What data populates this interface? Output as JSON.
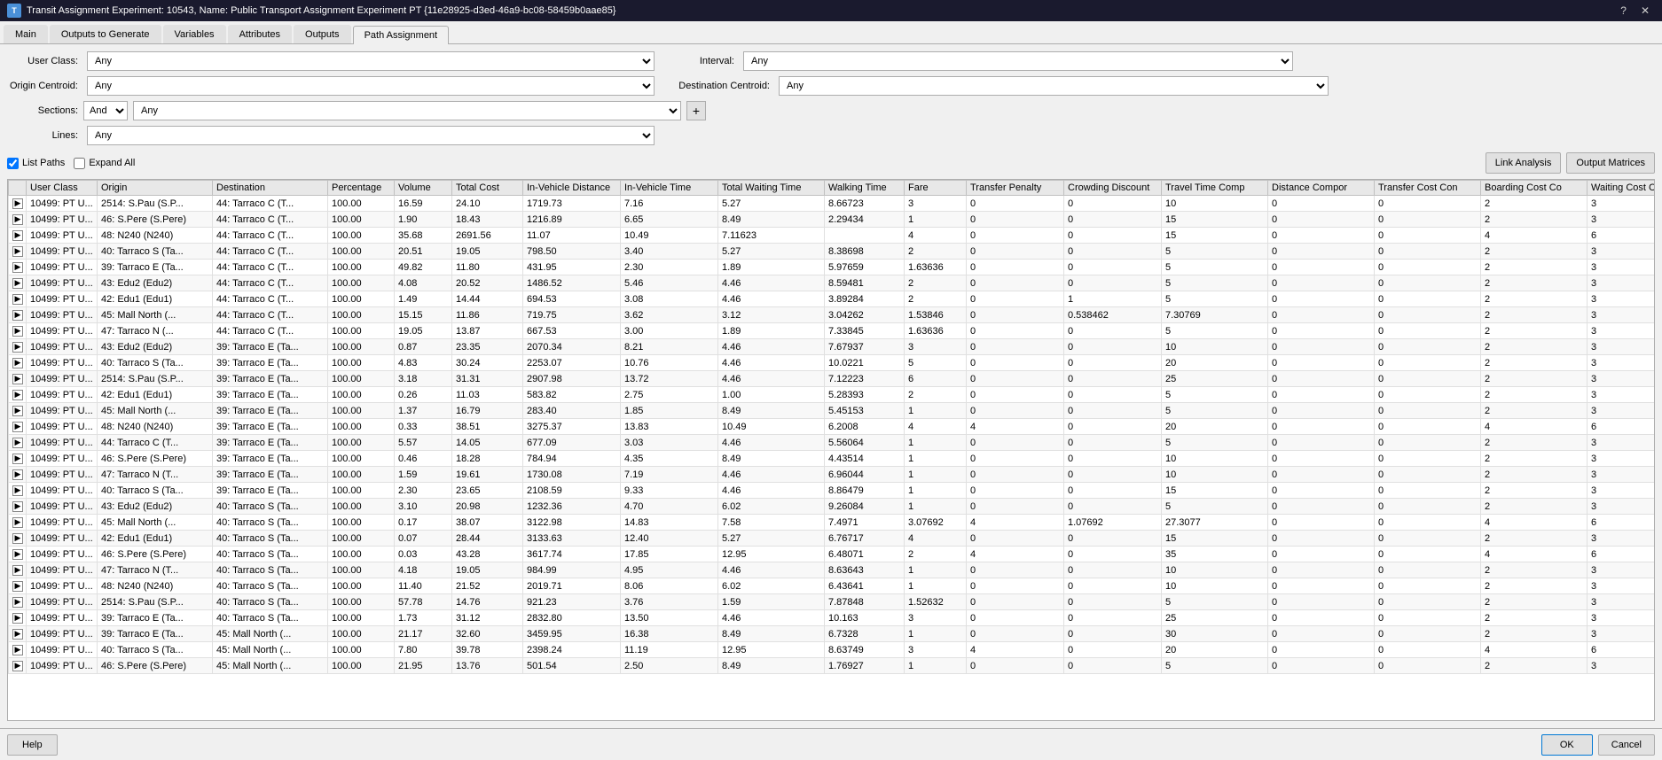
{
  "titleBar": {
    "title": "Transit Assignment Experiment: 10543, Name: Public Transport Assignment Experiment PT {11e28925-d3ed-46a9-bc08-58459b0aae85}",
    "helpBtn": "?",
    "closeBtn": "✕"
  },
  "tabs": [
    {
      "label": "Main",
      "active": false
    },
    {
      "label": "Outputs to Generate",
      "active": false
    },
    {
      "label": "Variables",
      "active": false
    },
    {
      "label": "Attributes",
      "active": false
    },
    {
      "label": "Outputs",
      "active": false
    },
    {
      "label": "Path Assignment",
      "active": true
    }
  ],
  "filters": {
    "userClassLabel": "User Class:",
    "userClassValue": "Any",
    "intervalLabel": "Interval:",
    "intervalValue": "Any",
    "originCentroidLabel": "Origin Centroid:",
    "originCentroidValue": "Any",
    "destCentroidLabel": "Destination Centroid:",
    "destCentroidValue": "Any",
    "sectionsLabel": "Sections:",
    "andValue": "And",
    "sectionsValue": "Any",
    "addBtn": "+",
    "linesLabel": "Lines:",
    "linesValue": "Any"
  },
  "toolbar": {
    "listPathsLabel": "List Paths",
    "expandAllLabel": "Expand All",
    "linkAnalysisBtn": "Link Analysis",
    "outputMatricesBtn": "Output Matrices"
  },
  "tableColumns": [
    {
      "id": "expand",
      "label": ""
    },
    {
      "id": "userClass",
      "label": "User Class"
    },
    {
      "id": "origin",
      "label": "Origin"
    },
    {
      "id": "destination",
      "label": "Destination"
    },
    {
      "id": "percentage",
      "label": "Percentage"
    },
    {
      "id": "volume",
      "label": "Volume"
    },
    {
      "id": "totalCost",
      "label": "Total Cost"
    },
    {
      "id": "inVehicleDistance",
      "label": "In-Vehicle Distance"
    },
    {
      "id": "inVehicleTime",
      "label": "In-Vehicle Time"
    },
    {
      "id": "totalWaitingTime",
      "label": "Total Waiting Time"
    },
    {
      "id": "walkingTime",
      "label": "Walking Time"
    },
    {
      "id": "fare",
      "label": "Fare"
    },
    {
      "id": "transferPenalty",
      "label": "Transfer Penalty"
    },
    {
      "id": "crowdingDiscount",
      "label": "Crowding Discount"
    },
    {
      "id": "travelTimeComp",
      "label": "Travel Time Comp"
    },
    {
      "id": "distanceComp",
      "label": "Distance Compor"
    },
    {
      "id": "transferCostCon",
      "label": "Transfer Cost Con"
    },
    {
      "id": "boardingCostCo",
      "label": "Boarding Cost Co"
    },
    {
      "id": "waitingCostCon",
      "label": "Waiting Cost Con"
    }
  ],
  "tableRows": [
    {
      "expand": true,
      "userClass": "10499: PT U...",
      "origin": "2514: S.Pau (S.P...",
      "dest": "44: Tarraco C (T...",
      "pct": "100.00",
      "vol": "16.59",
      "cost": "24.10",
      "invDist": "1719.73",
      "invTime": "7.16",
      "wait": "5.27",
      "walk": "8.66723",
      "fare": "3",
      "transfer": "0",
      "crowd": "0",
      "travelComp": "10",
      "distComp": "0",
      "transferCost": "0",
      "boarding": "2",
      "waitCost": "3"
    },
    {
      "expand": true,
      "userClass": "10499: PT U...",
      "origin": "46: S.Pere (S.Pere)",
      "dest": "44: Tarraco C (T...",
      "pct": "100.00",
      "vol": "1.90",
      "cost": "18.43",
      "invDist": "1216.89",
      "invTime": "6.65",
      "wait": "8.49",
      "walk": "2.29434",
      "fare": "1",
      "transfer": "0",
      "crowd": "0",
      "travelComp": "15",
      "distComp": "0",
      "transferCost": "0",
      "boarding": "2",
      "waitCost": "3"
    },
    {
      "expand": true,
      "userClass": "10499: PT U...",
      "origin": "48: N240 (N240)",
      "dest": "44: Tarraco C (T...",
      "pct": "100.00",
      "vol": "35.68",
      "cost": "2691.56",
      "invDist": "11.07",
      "invTime": "10.49",
      "wait": "7.11623",
      "fare": "4",
      "transfer": "0",
      "crowd": "0",
      "travelComp": "15",
      "distComp": "0",
      "transferCost": "0",
      "boarding": "4",
      "waitCost": "6"
    },
    {
      "expand": true,
      "userClass": "10499: PT U...",
      "origin": "40: Tarraco S (Ta...",
      "dest": "44: Tarraco C (T...",
      "pct": "100.00",
      "vol": "20.51",
      "cost": "19.05",
      "invDist": "798.50",
      "invTime": "3.40",
      "wait": "5.27",
      "walk": "8.38698",
      "fare": "2",
      "transfer": "0",
      "crowd": "0",
      "travelComp": "5",
      "distComp": "0",
      "transferCost": "0",
      "boarding": "2",
      "waitCost": "3"
    },
    {
      "expand": true,
      "userClass": "10499: PT U...",
      "origin": "39: Tarraco E (Ta...",
      "dest": "44: Tarraco C (T...",
      "pct": "100.00",
      "vol": "49.82",
      "cost": "11.80",
      "invDist": "431.95",
      "invTime": "2.30",
      "wait": "1.89",
      "walk": "5.97659",
      "fare": "1.63636",
      "transfer": "0",
      "crowd": "0",
      "travelComp": "5",
      "distComp": "0",
      "transferCost": "0",
      "boarding": "2",
      "waitCost": "3"
    },
    {
      "expand": true,
      "userClass": "10499: PT U...",
      "origin": "43: Edu2 (Edu2)",
      "dest": "44: Tarraco C (T...",
      "pct": "100.00",
      "vol": "4.08",
      "cost": "20.52",
      "invDist": "1486.52",
      "invTime": "5.46",
      "wait": "4.46",
      "walk": "8.59481",
      "fare": "2",
      "transfer": "0",
      "crowd": "0",
      "travelComp": "5",
      "distComp": "0",
      "transferCost": "0",
      "boarding": "2",
      "waitCost": "3"
    },
    {
      "expand": true,
      "userClass": "10499: PT U...",
      "origin": "42: Edu1 (Edu1)",
      "dest": "44: Tarraco C (T...",
      "pct": "100.00",
      "vol": "1.49",
      "cost": "14.44",
      "invDist": "694.53",
      "invTime": "3.08",
      "wait": "4.46",
      "walk": "3.89284",
      "fare": "2",
      "transfer": "0",
      "crowd": "1",
      "travelComp": "5",
      "distComp": "0",
      "transferCost": "0",
      "boarding": "2",
      "waitCost": "3"
    },
    {
      "expand": true,
      "userClass": "10499: PT U...",
      "origin": "45: Mall North (...",
      "dest": "44: Tarraco C (T...",
      "pct": "100.00",
      "vol": "15.15",
      "cost": "11.86",
      "invDist": "719.75",
      "invTime": "3.62",
      "wait": "3.12",
      "walk": "3.04262",
      "fare": "1.53846",
      "transfer": "0",
      "crowd": "0.538462",
      "travelComp": "7.30769",
      "distComp": "0",
      "transferCost": "0",
      "boarding": "2",
      "waitCost": "3"
    },
    {
      "expand": true,
      "userClass": "10499: PT U...",
      "origin": "47: Tarraco N (...",
      "dest": "44: Tarraco C (T...",
      "pct": "100.00",
      "vol": "19.05",
      "cost": "13.87",
      "invDist": "667.53",
      "invTime": "3.00",
      "wait": "1.89",
      "walk": "7.33845",
      "fare": "1.63636",
      "transfer": "0",
      "crowd": "0",
      "travelComp": "5",
      "distComp": "0",
      "transferCost": "0",
      "boarding": "2",
      "waitCost": "3"
    },
    {
      "expand": true,
      "userClass": "10499: PT U...",
      "origin": "43: Edu2 (Edu2)",
      "dest": "39: Tarraco E (Ta...",
      "pct": "100.00",
      "vol": "0.87",
      "cost": "23.35",
      "invDist": "2070.34",
      "invTime": "8.21",
      "wait": "4.46",
      "walk": "7.67937",
      "fare": "3",
      "transfer": "0",
      "crowd": "0",
      "travelComp": "10",
      "distComp": "0",
      "transferCost": "0",
      "boarding": "2",
      "waitCost": "3"
    },
    {
      "expand": true,
      "userClass": "10499: PT U...",
      "origin": "40: Tarraco S (Ta...",
      "dest": "39: Tarraco E (Ta...",
      "pct": "100.00",
      "vol": "4.83",
      "cost": "30.24",
      "invDist": "2253.07",
      "invTime": "10.76",
      "wait": "4.46",
      "walk": "10.0221",
      "fare": "5",
      "transfer": "0",
      "crowd": "0",
      "travelComp": "20",
      "distComp": "0",
      "transferCost": "0",
      "boarding": "2",
      "waitCost": "3"
    },
    {
      "expand": true,
      "userClass": "10499: PT U...",
      "origin": "2514: S.Pau (S.P...",
      "dest": "39: Tarraco E (Ta...",
      "pct": "100.00",
      "vol": "3.18",
      "cost": "31.31",
      "invDist": "2907.98",
      "invTime": "13.72",
      "wait": "4.46",
      "walk": "7.12223",
      "fare": "6",
      "transfer": "0",
      "crowd": "0",
      "travelComp": "25",
      "distComp": "0",
      "transferCost": "0",
      "boarding": "2",
      "waitCost": "3"
    },
    {
      "expand": true,
      "userClass": "10499: PT U...",
      "origin": "42: Edu1 (Edu1)",
      "dest": "39: Tarraco E (Ta...",
      "pct": "100.00",
      "vol": "0.26",
      "cost": "11.03",
      "invDist": "583.82",
      "invTime": "2.75",
      "wait": "1.00",
      "walk": "5.28393",
      "fare": "2",
      "transfer": "0",
      "crowd": "0",
      "travelComp": "5",
      "distComp": "0",
      "transferCost": "0",
      "boarding": "2",
      "waitCost": "3"
    },
    {
      "expand": true,
      "userClass": "10499: PT U...",
      "origin": "45: Mall North (...",
      "dest": "39: Tarraco E (Ta...",
      "pct": "100.00",
      "vol": "1.37",
      "cost": "16.79",
      "invDist": "283.40",
      "invTime": "1.85",
      "wait": "8.49",
      "walk": "5.45153",
      "fare": "1",
      "transfer": "0",
      "crowd": "0",
      "travelComp": "5",
      "distComp": "0",
      "transferCost": "0",
      "boarding": "2",
      "waitCost": "3"
    },
    {
      "expand": true,
      "userClass": "10499: PT U...",
      "origin": "48: N240 (N240)",
      "dest": "39: Tarraco E (Ta...",
      "pct": "100.00",
      "vol": "0.33",
      "cost": "38.51",
      "invDist": "3275.37",
      "invTime": "13.83",
      "wait": "10.49",
      "walk": "6.2008",
      "fare": "4",
      "transfer": "4",
      "crowd": "0",
      "travelComp": "20",
      "distComp": "0",
      "transferCost": "0",
      "boarding": "4",
      "waitCost": "6"
    },
    {
      "expand": true,
      "userClass": "10499: PT U...",
      "origin": "44: Tarraco C (T...",
      "dest": "39: Tarraco E (Ta...",
      "pct": "100.00",
      "vol": "5.57",
      "cost": "14.05",
      "invDist": "677.09",
      "invTime": "3.03",
      "wait": "4.46",
      "walk": "5.56064",
      "fare": "1",
      "transfer": "0",
      "crowd": "0",
      "travelComp": "5",
      "distComp": "0",
      "transferCost": "0",
      "boarding": "2",
      "waitCost": "3"
    },
    {
      "expand": true,
      "userClass": "10499: PT U...",
      "origin": "46: S.Pere (S.Pere)",
      "dest": "39: Tarraco E (Ta...",
      "pct": "100.00",
      "vol": "0.46",
      "cost": "18.28",
      "invDist": "784.94",
      "invTime": "4.35",
      "wait": "8.49",
      "walk": "4.43514",
      "fare": "1",
      "transfer": "0",
      "crowd": "0",
      "travelComp": "10",
      "distComp": "0",
      "transferCost": "0",
      "boarding": "2",
      "waitCost": "3"
    },
    {
      "expand": true,
      "userClass": "10499: PT U...",
      "origin": "47: Tarraco N (T...",
      "dest": "39: Tarraco E (Ta...",
      "pct": "100.00",
      "vol": "1.59",
      "cost": "19.61",
      "invDist": "1730.08",
      "invTime": "7.19",
      "wait": "4.46",
      "walk": "6.96044",
      "fare": "1",
      "transfer": "0",
      "crowd": "0",
      "travelComp": "10",
      "distComp": "0",
      "transferCost": "0",
      "boarding": "2",
      "waitCost": "3"
    },
    {
      "expand": true,
      "userClass": "10499: PT U...",
      "origin": "40: Tarraco S (Ta...",
      "dest": "39: Tarraco E (Ta...",
      "pct": "100.00",
      "vol": "2.30",
      "cost": "23.65",
      "invDist": "2108.59",
      "invTime": "9.33",
      "wait": "4.46",
      "walk": "8.86479",
      "fare": "1",
      "transfer": "0",
      "crowd": "0",
      "travelComp": "15",
      "distComp": "0",
      "transferCost": "0",
      "boarding": "2",
      "waitCost": "3"
    },
    {
      "expand": true,
      "userClass": "10499: PT U...",
      "origin": "43: Edu2 (Edu2)",
      "dest": "40: Tarraco S (Ta...",
      "pct": "100.00",
      "vol": "3.10",
      "cost": "20.98",
      "invDist": "1232.36",
      "invTime": "4.70",
      "wait": "6.02",
      "walk": "9.26084",
      "fare": "1",
      "transfer": "0",
      "crowd": "0",
      "travelComp": "5",
      "distComp": "0",
      "transferCost": "0",
      "boarding": "2",
      "waitCost": "3"
    },
    {
      "expand": true,
      "userClass": "10499: PT U...",
      "origin": "45: Mall North (...",
      "dest": "40: Tarraco S (Ta...",
      "pct": "100.00",
      "vol": "0.17",
      "cost": "38.07",
      "invDist": "3122.98",
      "invTime": "14.83",
      "wait": "7.58",
      "walk": "7.4971",
      "fare": "3.07692",
      "transfer": "4",
      "crowd": "1.07692",
      "travelComp": "27.3077",
      "distComp": "0",
      "transferCost": "0",
      "boarding": "4",
      "waitCost": "6"
    },
    {
      "expand": true,
      "userClass": "10499: PT U...",
      "origin": "42: Edu1 (Edu1)",
      "dest": "40: Tarraco S (Ta...",
      "pct": "100.00",
      "vol": "0.07",
      "cost": "28.44",
      "invDist": "3133.63",
      "invTime": "12.40",
      "wait": "5.27",
      "walk": "6.76717",
      "fare": "4",
      "transfer": "0",
      "crowd": "0",
      "travelComp": "15",
      "distComp": "0",
      "transferCost": "0",
      "boarding": "2",
      "waitCost": "3"
    },
    {
      "expand": true,
      "userClass": "10499: PT U...",
      "origin": "46: S.Pere (S.Pere)",
      "dest": "40: Tarraco S (Ta...",
      "pct": "100.00",
      "vol": "0.03",
      "cost": "43.28",
      "invDist": "3617.74",
      "invTime": "17.85",
      "wait": "12.95",
      "walk": "6.48071",
      "fare": "2",
      "transfer": "4",
      "crowd": "0",
      "travelComp": "35",
      "distComp": "0",
      "transferCost": "0",
      "boarding": "4",
      "waitCost": "6"
    },
    {
      "expand": true,
      "userClass": "10499: PT U...",
      "origin": "47: Tarraco N (T...",
      "dest": "40: Tarraco S (Ta...",
      "pct": "100.00",
      "vol": "4.18",
      "cost": "19.05",
      "invDist": "984.99",
      "invTime": "4.95",
      "wait": "4.46",
      "walk": "8.63643",
      "fare": "1",
      "transfer": "0",
      "crowd": "0",
      "travelComp": "10",
      "distComp": "0",
      "transferCost": "0",
      "boarding": "2",
      "waitCost": "3"
    },
    {
      "expand": true,
      "userClass": "10499: PT U...",
      "origin": "48: N240 (N240)",
      "dest": "40: Tarraco S (Ta...",
      "pct": "100.00",
      "vol": "11.40",
      "cost": "21.52",
      "invDist": "2019.71",
      "invTime": "8.06",
      "wait": "6.02",
      "walk": "6.43641",
      "fare": "1",
      "transfer": "0",
      "crowd": "0",
      "travelComp": "10",
      "distComp": "0",
      "transferCost": "0",
      "boarding": "2",
      "waitCost": "3"
    },
    {
      "expand": true,
      "userClass": "10499: PT U...",
      "origin": "2514: S.Pau (S.P...",
      "dest": "40: Tarraco S (Ta...",
      "pct": "100.00",
      "vol": "57.78",
      "cost": "14.76",
      "invDist": "921.23",
      "invTime": "3.76",
      "wait": "1.59",
      "walk": "7.87848",
      "fare": "1.52632",
      "transfer": "0",
      "crowd": "0",
      "travelComp": "5",
      "distComp": "0",
      "transferCost": "0",
      "boarding": "2",
      "waitCost": "3"
    },
    {
      "expand": true,
      "userClass": "10499: PT U...",
      "origin": "39: Tarraco E (Ta...",
      "dest": "40: Tarraco S (Ta...",
      "pct": "100.00",
      "vol": "1.73",
      "cost": "31.12",
      "invDist": "2832.80",
      "invTime": "13.50",
      "wait": "4.46",
      "walk": "10.163",
      "fare": "3",
      "transfer": "0",
      "crowd": "0",
      "travelComp": "25",
      "distComp": "0",
      "transferCost": "0",
      "boarding": "2",
      "waitCost": "3"
    },
    {
      "expand": true,
      "userClass": "10499: PT U...",
      "origin": "39: Tarraco E (Ta...",
      "dest": "45: Mall North (...",
      "pct": "100.00",
      "vol": "21.17",
      "cost": "32.60",
      "invDist": "3459.95",
      "invTime": "16.38",
      "wait": "8.49",
      "walk": "6.7328",
      "fare": "1",
      "transfer": "0",
      "crowd": "0",
      "travelComp": "30",
      "distComp": "0",
      "transferCost": "0",
      "boarding": "2",
      "waitCost": "3"
    },
    {
      "expand": true,
      "userClass": "10499: PT U...",
      "origin": "40: Tarraco S (Ta...",
      "dest": "45: Mall North (...",
      "pct": "100.00",
      "vol": "7.80",
      "cost": "39.78",
      "invDist": "2398.24",
      "invTime": "11.19",
      "wait": "12.95",
      "walk": "8.63749",
      "fare": "3",
      "transfer": "4",
      "crowd": "0",
      "travelComp": "20",
      "distComp": "0",
      "transferCost": "0",
      "boarding": "4",
      "waitCost": "6"
    },
    {
      "expand": true,
      "userClass": "10499: PT U...",
      "origin": "46: S.Pere (S.Pere)",
      "dest": "45: Mall North (...",
      "pct": "100.00",
      "vol": "21.95",
      "cost": "13.76",
      "invDist": "501.54",
      "invTime": "2.50",
      "wait": "8.49",
      "walk": "1.76927",
      "fare": "1",
      "transfer": "0",
      "crowd": "0",
      "travelComp": "5",
      "distComp": "0",
      "transferCost": "0",
      "boarding": "2",
      "waitCost": "3"
    }
  ],
  "bottomBar": {
    "helpLabel": "Help",
    "okLabel": "OK",
    "cancelLabel": "Cancel"
  }
}
